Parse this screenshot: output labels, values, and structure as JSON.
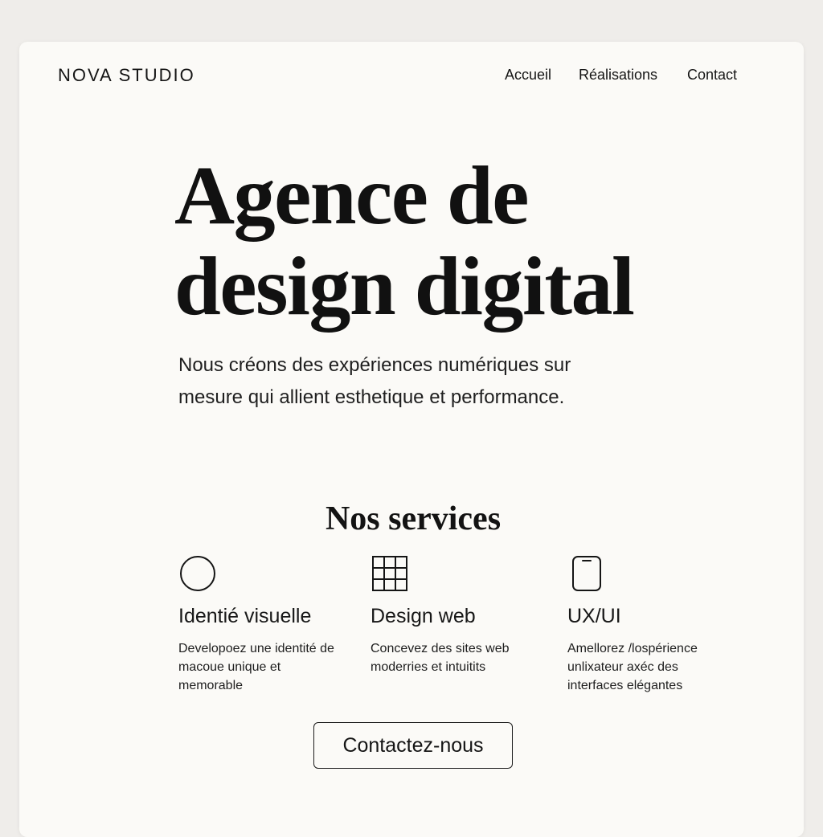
{
  "header": {
    "brand": "NOVA STUDIO",
    "nav": {
      "home": "Accueil",
      "work": "Réalisations",
      "contact": "Contact"
    }
  },
  "hero": {
    "title_line1": "Agence de",
    "title_line2": "design digital",
    "subtitle": "Nous créons des expériences numériques sur mesure qui allient esthetique et performance."
  },
  "services": {
    "title": "Nos services",
    "items": [
      {
        "icon": "circle-icon",
        "name": "Identié visuelle",
        "description": "Developoez une identité de macoue unique et memorable"
      },
      {
        "icon": "grid-icon",
        "name": "Design web",
        "description": "Concevez des sites web moderries et intuitits"
      },
      {
        "icon": "mobile-icon",
        "name": "UX/UI",
        "description": "Amellorez /lospérience unlixateur axéc des interfaces elégantes"
      }
    ]
  },
  "cta": {
    "label": "Contactez-nous"
  },
  "colors": {
    "background": "#efedea",
    "card": "#fbfaf7",
    "text": "#151515"
  }
}
